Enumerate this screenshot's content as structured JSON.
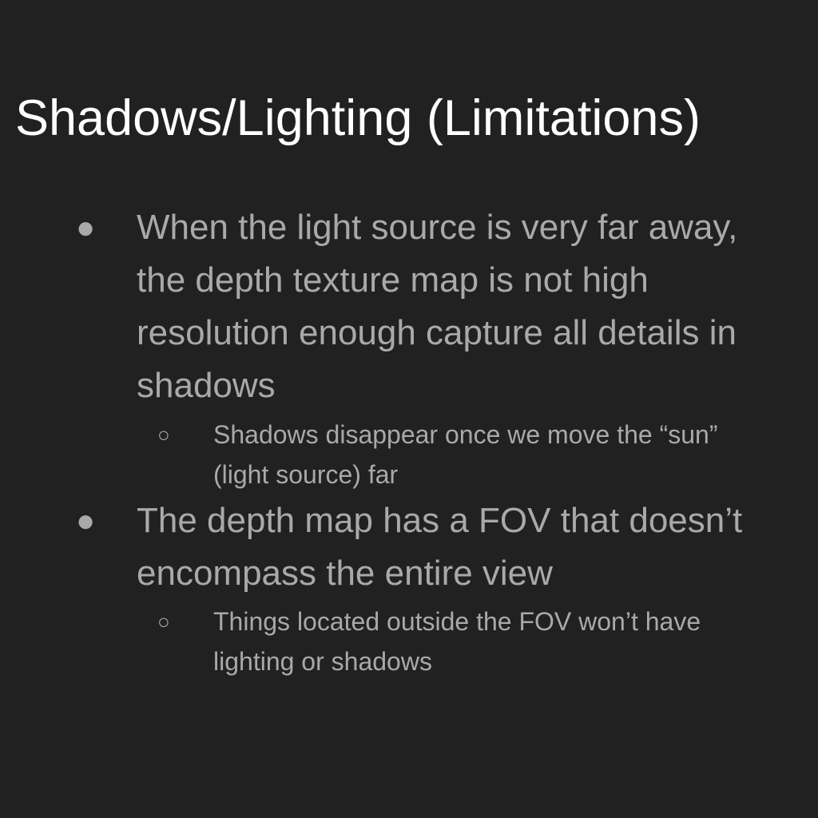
{
  "slide": {
    "title": "Shadows/Lighting (Limitations)",
    "bullets": [
      {
        "text": "When the light source is very far away, the depth texture map is not high resolution enough capture all details in shadows",
        "marker": "●",
        "sub": [
          {
            "text": "Shadows disappear once we move the “sun” (light source) far",
            "marker": "○"
          }
        ]
      },
      {
        "text": "The depth map has a FOV that doesn’t encompass the entire view",
        "marker": "●",
        "sub": [
          {
            "text": "Things located outside the FOV won’t have lighting or shadows",
            "marker": "○"
          }
        ]
      }
    ]
  }
}
